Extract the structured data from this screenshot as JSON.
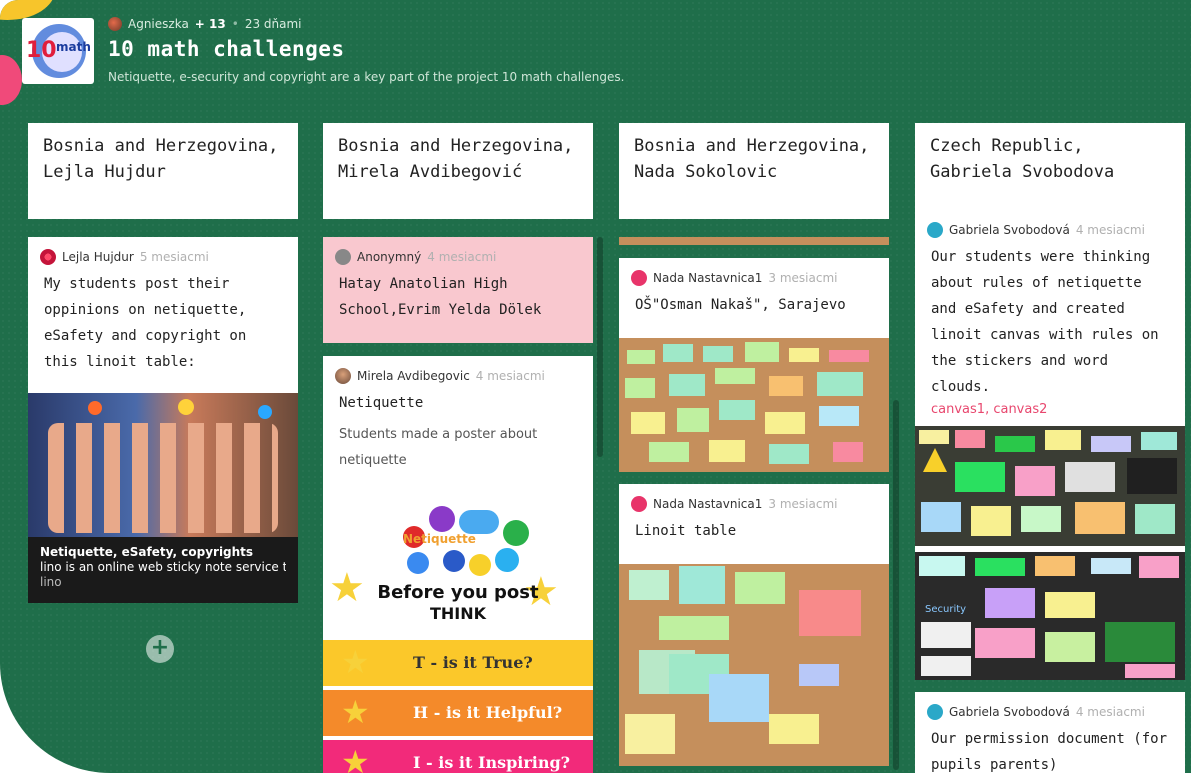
{
  "header": {
    "author": "Agnieszka",
    "plus_count": "+ 13",
    "age": "23 dňami",
    "title": "10 math challenges",
    "description": "Netiquette, e-security and copyright are a key part of the project 10 math challenges.",
    "logo_text": "10 math"
  },
  "columns": [
    {
      "title": "Bosnia and Herzegovina, Lejla Hujdur",
      "cards": [
        {
          "author": "Lejla Hujdur",
          "time": "5 mesiacmi",
          "text": "My students post their oppinions on netiquette, eSafety and copyright on this linoit table:",
          "link_title": "Netiquette, eSafety, copyrights",
          "link_desc": "lino is an online web sticky note service t...",
          "link_site": "lino"
        }
      ],
      "add_label": "+"
    },
    {
      "title": "Bosnia and Herzegovina, Mirela Avdibegović",
      "cards": [
        {
          "author": "Anonymný",
          "time": "4 mesiacmi",
          "text": "Hatay Anatolian High School,Evrim Yelda Dölek"
        },
        {
          "author": "Mirela Avdibegovic",
          "time": "4 mesiacmi",
          "text": "Netiquette",
          "subtext": "Students made a poster about netiquette",
          "poster": {
            "brand": "Netiquette",
            "headline_1": "Before you post",
            "headline_2": "THINK",
            "rows": [
              "T - is it True?",
              "H - is it Helpful?",
              "I - is it Inspiring?"
            ]
          }
        }
      ]
    },
    {
      "title": "Bosnia and Herzegovina, Nada Sokolovic",
      "cards": [
        {
          "author": "Nada Nastavnica1",
          "time": "3 mesiacmi",
          "text": "OŠ\"Osman Nakaš\", Sarajevo"
        },
        {
          "author": "Nada Nastavnica1",
          "time": "3 mesiacmi",
          "text": "Linoit table"
        }
      ]
    },
    {
      "title": "Czech Republic, Gabriela Svobodova",
      "cards": [
        {
          "author": "Gabriela Svobodová",
          "time": "4 mesiacmi",
          "text": "Our students were thinking about rules of netiquette and eSafety and created linoit canvas with rules on the stickers and word clouds.",
          "links": [
            "canvas1",
            "canvas2"
          ],
          "preview_text_1": "Security"
        },
        {
          "author": "Gabriela Svobodová",
          "time": "4 mesiacmi",
          "text": "Our permission document (for pupils parents)"
        }
      ]
    }
  ],
  "colors": {
    "board_bg": "#1f6e4a",
    "pink_card": "#f9c8cf",
    "link": "#e8476e",
    "cork": "#c58f5c"
  }
}
